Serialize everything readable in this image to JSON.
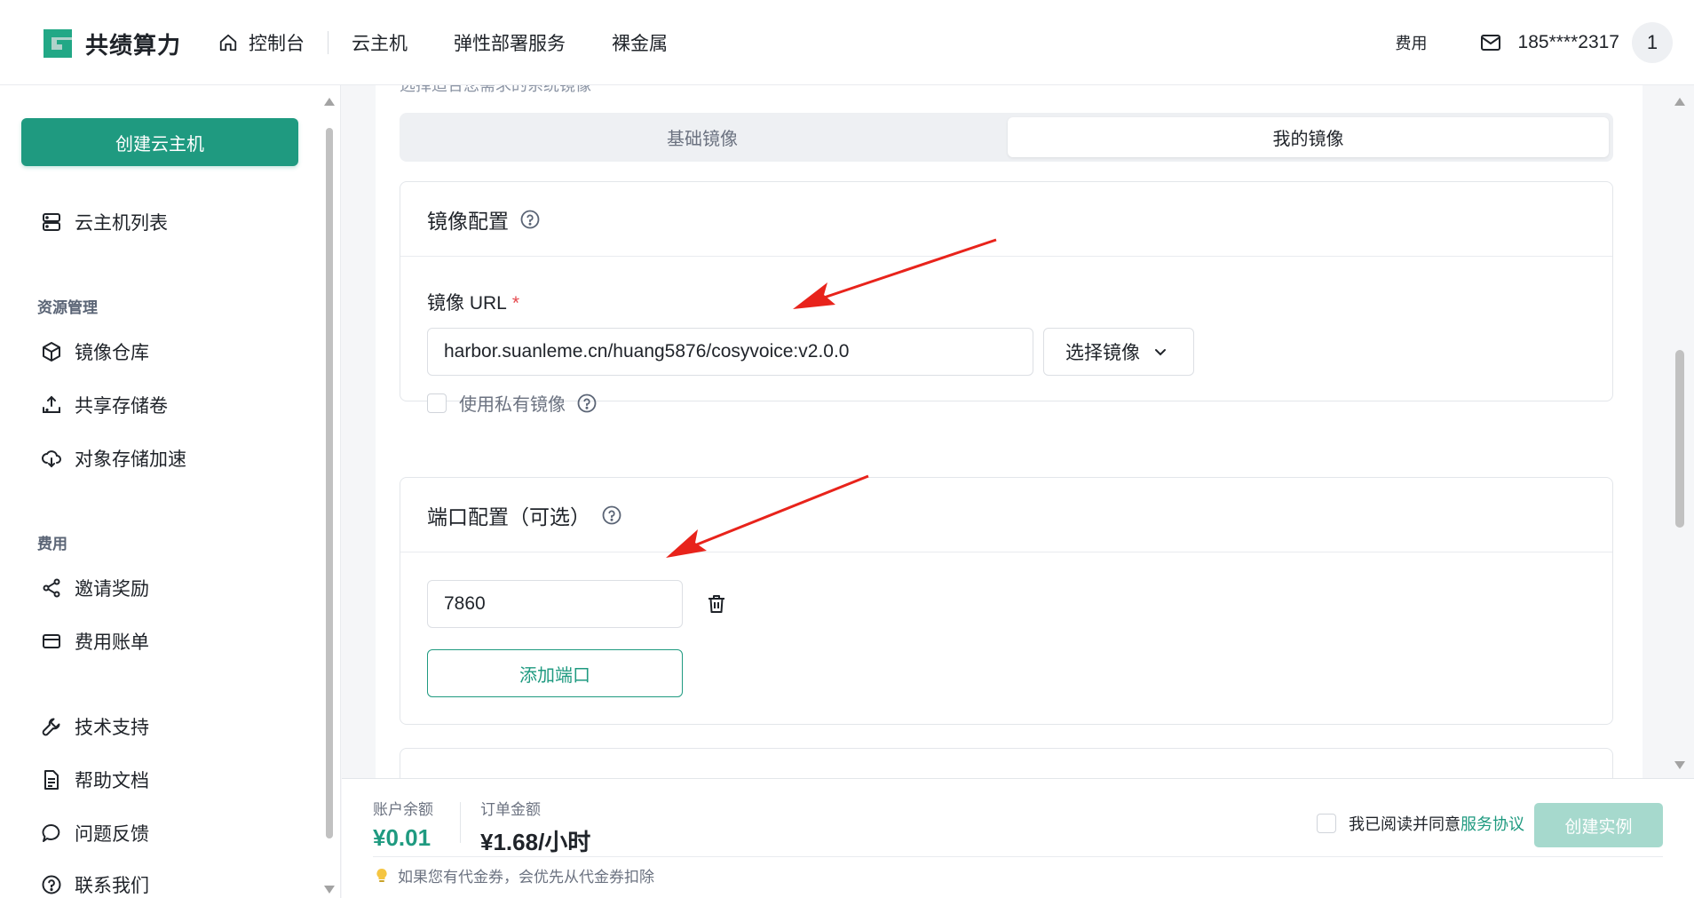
{
  "header": {
    "brand": "共绩算力",
    "nav": [
      {
        "label": "控制台",
        "icon": "home-icon"
      },
      {
        "label": "云主机"
      },
      {
        "label": "弹性部署服务"
      },
      {
        "label": "裸金属"
      }
    ],
    "fee_label": "费用",
    "phone": "185****2317",
    "avatar": "1"
  },
  "sidebar": {
    "create_label": "创建云主机",
    "list_label": "云主机列表",
    "group_resources": "资源管理",
    "resources": [
      {
        "label": "镜像仓库",
        "icon": "cube-icon"
      },
      {
        "label": "共享存储卷",
        "icon": "upload-icon"
      },
      {
        "label": "对象存储加速",
        "icon": "cloud-sync-icon"
      }
    ],
    "group_fees": "费用",
    "fees": [
      {
        "label": "邀请奖励",
        "icon": "share-icon"
      },
      {
        "label": "费用账单",
        "icon": "card-icon"
      }
    ],
    "support": [
      {
        "label": "技术支持",
        "icon": "wrench-icon"
      },
      {
        "label": "帮助文档",
        "icon": "document-icon"
      },
      {
        "label": "问题反馈",
        "icon": "chat-icon"
      },
      {
        "label": "联系我们",
        "icon": "question-icon"
      }
    ]
  },
  "main": {
    "subtitle": "选择适合您需求的系统镜像",
    "tabs": [
      {
        "label": "基础镜像",
        "active": false
      },
      {
        "label": "我的镜像",
        "active": true
      }
    ],
    "image_config": {
      "title": "镜像配置",
      "url_label": "镜像 URL",
      "required_mark": "*",
      "url_value": "harbor.suanleme.cn/huang5876/cosyvoice:v2.0.0",
      "select_label": "选择镜像",
      "private_label": "使用私有镜像"
    },
    "port_config": {
      "title": "端口配置（可选）",
      "port_value": "7860",
      "add_label": "添加端口"
    }
  },
  "footer": {
    "balance_label": "账户余额",
    "balance_value": "¥0.01",
    "order_label": "订单金额",
    "order_value": "¥1.68/小时",
    "agree_prefix": "我已阅读并同意",
    "agree_link": "服务协议",
    "create_label": "创建实例",
    "tip": "如果您有代金券，会优先从代金券扣除"
  },
  "colors": {
    "brand": "#1f9a80",
    "brand_disabled": "#a6d9cd",
    "annotation_arrow": "#e8231b"
  }
}
